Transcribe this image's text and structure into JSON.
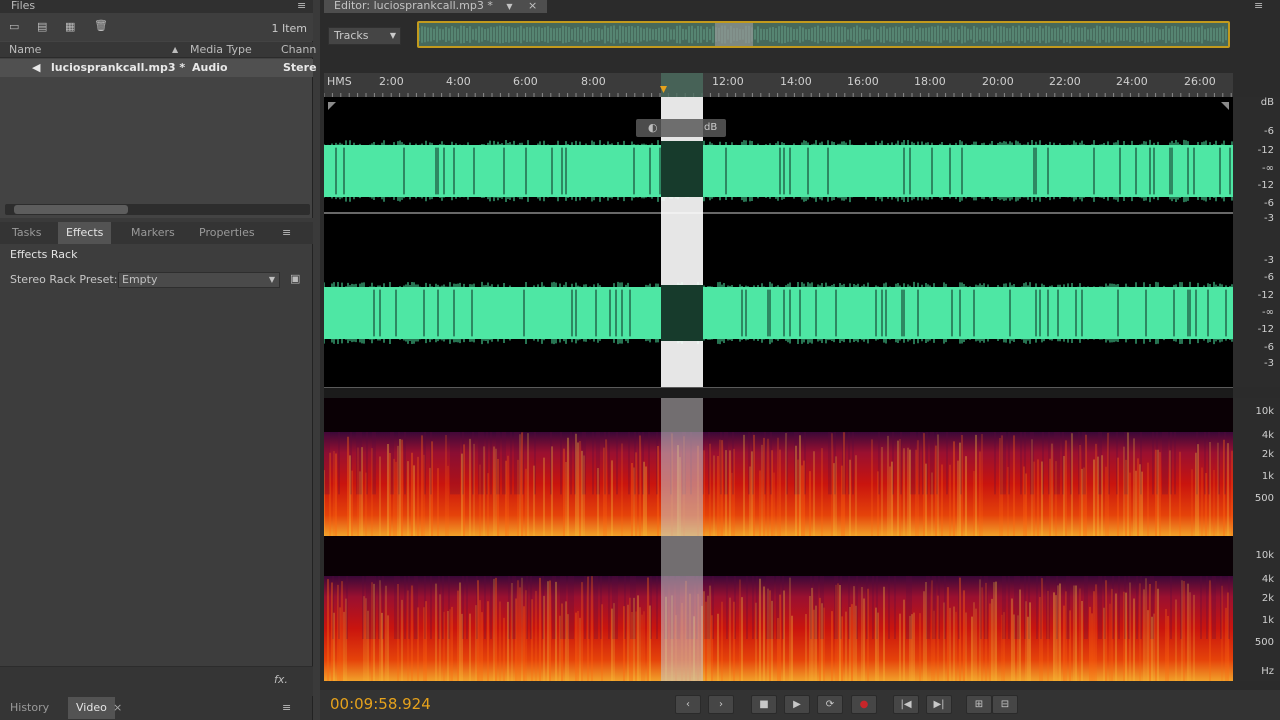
{
  "files": {
    "title": "Files",
    "item_count": "1 Item",
    "columns": {
      "name": "Name",
      "media_type": "Media Type",
      "channels": "Chann"
    },
    "row": {
      "name": "luciosprankcall.mp3 *",
      "media_type": "Audio",
      "channels": "Stere"
    }
  },
  "effects": {
    "tabs": [
      "Tasks",
      "Effects",
      "Markers",
      "Properties"
    ],
    "active_tab": "Effects",
    "rack_title": "Effects Rack",
    "preset_label": "Stereo Rack Preset:",
    "preset_value": "Empty",
    "fx_label": "fx."
  },
  "history": {
    "tabs": [
      "History",
      "Video"
    ]
  },
  "editor": {
    "tab_title": "Editor: luciosprankcall.mp3 *",
    "tracks_label": "Tracks",
    "ruler_unit": "HMS",
    "ruler_labels": [
      "2:00",
      "4:00",
      "6:00",
      "8:00",
      "12:00",
      "14:00",
      "16:00",
      "18:00",
      "20:00",
      "22:00",
      "24:00",
      "26:00"
    ],
    "hud_label": "dB",
    "db_scale": [
      "dB",
      "-6",
      "-12",
      "-∞",
      "-12",
      "-6",
      "-3",
      "-3",
      "-6",
      "-12",
      "-∞",
      "-12",
      "-6",
      "-3"
    ],
    "hz_scale_top": [
      "10k",
      "4k",
      "2k",
      "1k",
      "500"
    ],
    "hz_scale_bottom": [
      "10k",
      "4k",
      "2k",
      "1k",
      "500",
      "Hz"
    ],
    "timecode": "00:09:58.924"
  },
  "colors": {
    "waveform": "#4ee7a4",
    "accent": "#e6a21c",
    "overview_border": "#c29a1d"
  }
}
